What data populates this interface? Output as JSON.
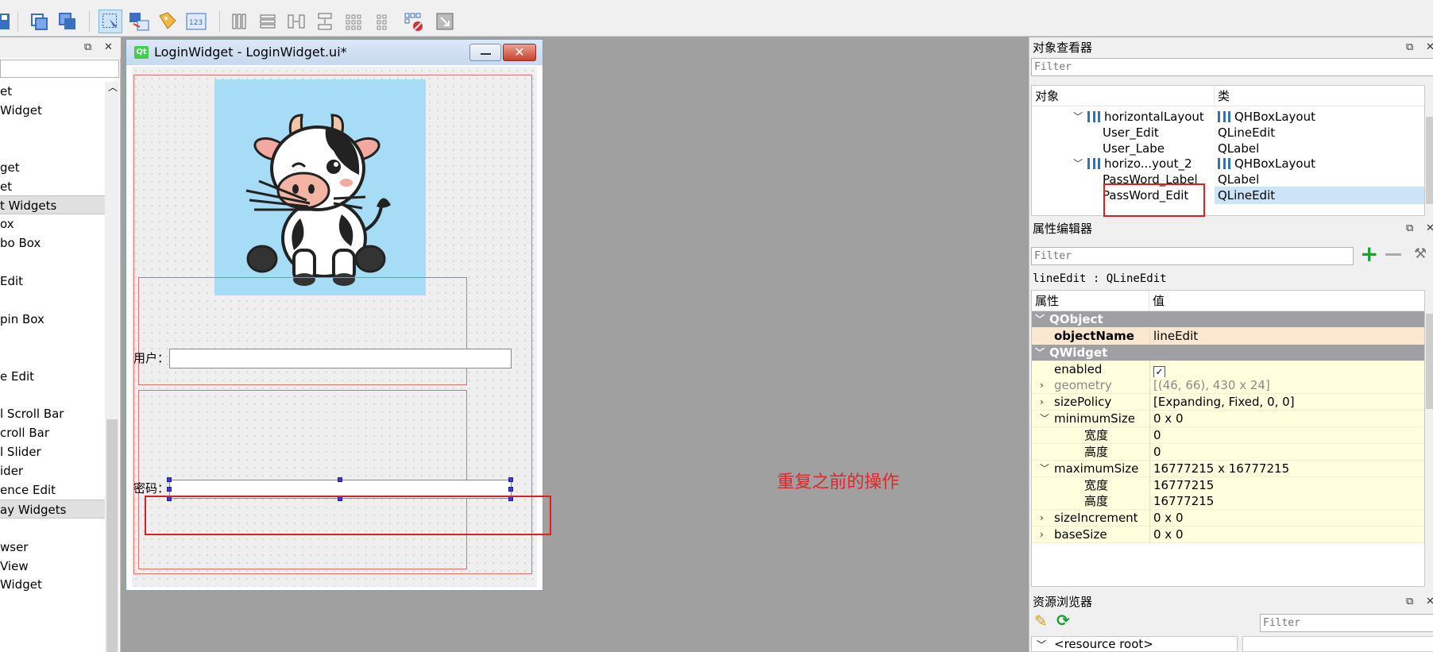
{
  "form": {
    "title": "LoginWidget - LoginWidget.ui*",
    "user_label": "用户：",
    "password_label": "密码："
  },
  "annotation": {
    "text": "重复之前的操作",
    "color": "#e0262c"
  },
  "widget_box": {
    "items": [
      {
        "text": "et",
        "category": false
      },
      {
        "text": "Widget",
        "category": false
      },
      {
        "text": "",
        "category": false
      },
      {
        "text": "",
        "category": false
      },
      {
        "text": "get",
        "category": false
      },
      {
        "text": "et",
        "category": false
      },
      {
        "text": "t Widgets",
        "category": true
      },
      {
        "text": "ox",
        "category": false
      },
      {
        "text": "bo Box",
        "category": false
      },
      {
        "text": "",
        "category": false
      },
      {
        "text": " Edit",
        "category": false
      },
      {
        "text": "",
        "category": false
      },
      {
        "text": "pin Box",
        "category": false
      },
      {
        "text": "",
        "category": false
      },
      {
        "text": "",
        "category": false
      },
      {
        "text": "e Edit",
        "category": false
      },
      {
        "text": "",
        "category": false
      },
      {
        "text": "l Scroll Bar",
        "category": false
      },
      {
        "text": "croll Bar",
        "category": false
      },
      {
        "text": "l Slider",
        "category": false
      },
      {
        "text": "ider",
        "category": false
      },
      {
        "text": "ence Edit",
        "category": false
      },
      {
        "text": "ay Widgets",
        "category": true
      },
      {
        "text": "",
        "category": false
      },
      {
        "text": "wser",
        "category": false
      },
      {
        "text": "View",
        "category": false
      },
      {
        "text": "Widget",
        "category": false
      }
    ]
  },
  "object_inspector": {
    "title": "对象查看器",
    "filter_placeholder": "Filter",
    "col_object": "对象",
    "col_class": "类",
    "rows": [
      {
        "name": "horizontalLayout",
        "cls": "QHBoxLayout",
        "layout": true,
        "selected": false
      },
      {
        "name": "User_Edit",
        "cls": "QLineEdit",
        "layout": false,
        "selected": false
      },
      {
        "name": "User_Labe",
        "cls": "QLabel",
        "layout": false,
        "selected": false
      },
      {
        "name": "horizo...yout_2",
        "cls": "QHBoxLayout",
        "layout": true,
        "selected": false
      },
      {
        "name": "PassWord_Label",
        "cls": "QLabel",
        "layout": false,
        "selected": false
      },
      {
        "name": "PassWord_Edit",
        "cls": "QLineEdit",
        "layout": false,
        "selected": true
      }
    ]
  },
  "property_editor": {
    "title": "属性编辑器",
    "filter_placeholder": "Filter",
    "object_info": "lineEdit : QLineEdit",
    "col_property": "属性",
    "col_value": "值",
    "rows": [
      {
        "name": "QObject",
        "value": "",
        "kind": "group",
        "expander": "v"
      },
      {
        "name": "objectName",
        "value": "lineEdit",
        "kind": "bold"
      },
      {
        "name": "QWidget",
        "value": "",
        "kind": "group",
        "expander": "v"
      },
      {
        "name": "enabled",
        "value": "✓",
        "kind": "checkbox"
      },
      {
        "name": "geometry",
        "value": "[(46, 66), 430 x 24]",
        "kind": "grey",
        "expander": ">"
      },
      {
        "name": "sizePolicy",
        "value": "[Expanding, Fixed, 0, 0]",
        "kind": "normal",
        "expander": ">"
      },
      {
        "name": "minimumSize",
        "value": "0 x 0",
        "kind": "normal",
        "expander": "v"
      },
      {
        "name": "宽度",
        "value": "0",
        "kind": "sub"
      },
      {
        "name": "高度",
        "value": "0",
        "kind": "sub"
      },
      {
        "name": "maximumSize",
        "value": "16777215 x 16777215",
        "kind": "normal",
        "expander": "v"
      },
      {
        "name": "宽度",
        "value": "16777215",
        "kind": "sub"
      },
      {
        "name": "高度",
        "value": "16777215",
        "kind": "sub"
      },
      {
        "name": "sizeIncrement",
        "value": "0 x 0",
        "kind": "normal",
        "expander": ">"
      },
      {
        "name": "baseSize",
        "value": "0 x 0",
        "kind": "normal",
        "expander": ">"
      }
    ]
  },
  "resource_browser": {
    "title": "资源浏览器",
    "filter_placeholder": "Filter",
    "root": "<resource root>"
  },
  "dock_float_icon": "⧉",
  "dock_close_icon": "✕"
}
